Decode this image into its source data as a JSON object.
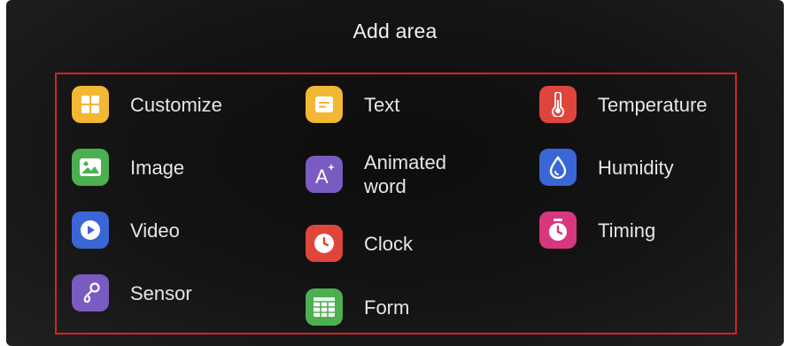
{
  "dialog": {
    "title": "Add area"
  },
  "items": {
    "customize": {
      "label": "Customize",
      "icon": "grid-icon",
      "color": "#f2b733"
    },
    "image": {
      "label": "Image",
      "icon": "image-icon",
      "color": "#4caf50"
    },
    "video": {
      "label": "Video",
      "icon": "play-icon",
      "color": "#3b66d6"
    },
    "sensor": {
      "label": "Sensor",
      "icon": "sensor-probe-icon",
      "color": "#7a5bc2"
    },
    "text": {
      "label": "Text",
      "icon": "text-icon",
      "color": "#f2b733"
    },
    "animated_word": {
      "label": "Animated\nword",
      "icon": "animated-letter-icon",
      "color": "#7a5bc2"
    },
    "clock": {
      "label": "Clock",
      "icon": "clock-icon",
      "color": "#e0453c"
    },
    "form": {
      "label": "Form",
      "icon": "table-icon",
      "color": "#4caf50"
    },
    "temperature": {
      "label": "Temperature",
      "icon": "thermometer-icon",
      "color": "#e0453c"
    },
    "humidity": {
      "label": "Humidity",
      "icon": "water-drop-icon",
      "color": "#3b66d6"
    },
    "timing": {
      "label": "Timing",
      "icon": "stopwatch-icon",
      "color": "#d8377f"
    }
  },
  "highlight_color": "#d0242b"
}
